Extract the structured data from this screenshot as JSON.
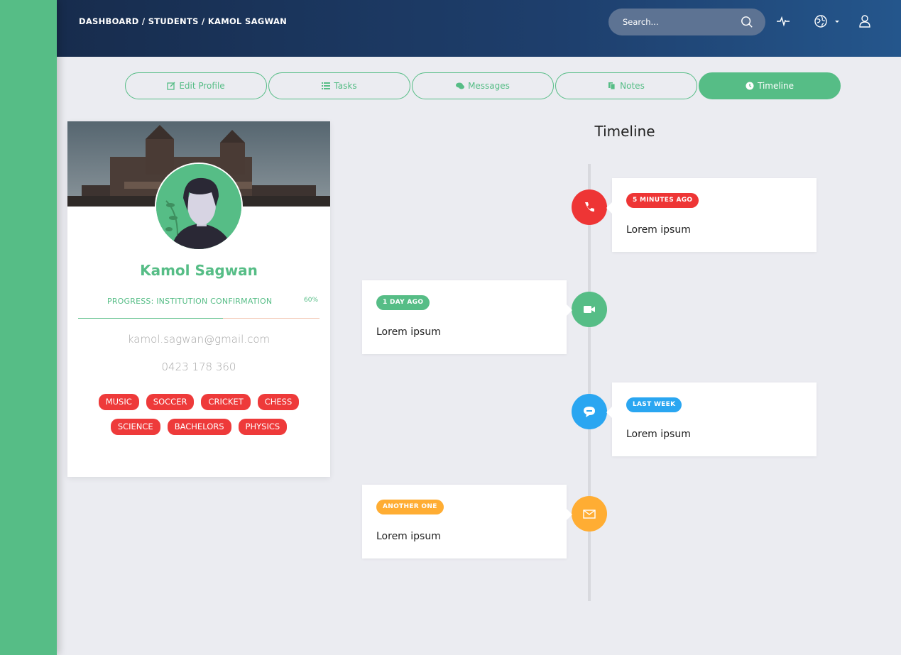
{
  "breadcrumb": "DASHBOARD / STUDENTS / KAMOL SAGWAN",
  "search": {
    "placeholder": "Search..."
  },
  "tabs": [
    {
      "label": "Edit Profile",
      "icon": "edit-icon"
    },
    {
      "label": "Tasks",
      "icon": "list-icon"
    },
    {
      "label": "Messages",
      "icon": "comments-icon"
    },
    {
      "label": "Notes",
      "icon": "files-icon"
    },
    {
      "label": "Timeline",
      "icon": "clock-icon",
      "active": true
    }
  ],
  "profile": {
    "name": "Kamol Sagwan",
    "progress_label": "PROGRESS: INSTITUTION CONFIRMATION",
    "progress_value": "60%",
    "progress_fraction": 0.6,
    "email": "kamol.sagwan@gmail.com",
    "phone": "0423 178 360",
    "tags": [
      "MUSIC",
      "SOCCER",
      "CRICKET",
      "CHESS",
      "SCIENCE",
      "BACHELORS",
      "PHYSICS"
    ]
  },
  "timeline": {
    "title": "Timeline",
    "items": [
      {
        "badge": "5 MINUTES AGO",
        "text": "Lorem ipsum",
        "color": "#ee3535",
        "icon": "phone-icon"
      },
      {
        "badge": "1 DAY AGO",
        "text": "Lorem ipsum",
        "color": "#56bd86",
        "icon": "video-icon"
      },
      {
        "badge": "LAST WEEK",
        "text": "Lorem ipsum",
        "color": "#2aa6f1",
        "icon": "sms-icon"
      },
      {
        "badge": "ANOTHER ONE",
        "text": "Lorem ipsum",
        "color": "#ffad33",
        "icon": "envelope-icon"
      }
    ]
  },
  "colors": {
    "accent": "#56bd86",
    "tag": "#ee3a3a",
    "header_start": "#172c4d",
    "header_end": "#24568c"
  }
}
